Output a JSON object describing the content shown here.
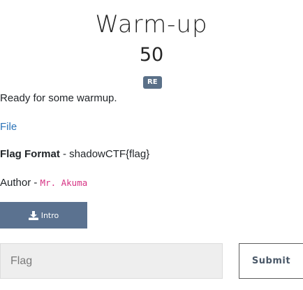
{
  "challenge": {
    "title": "Warm-up",
    "points": "50",
    "category": "RE",
    "description": "Ready for some warmup.",
    "file_link": "File",
    "flag_format_label": "Flag Format",
    "flag_format_value": " - shadowCTF{flag}",
    "author_label": "Author - ",
    "author_name": "Mr. Akuma"
  },
  "actions": {
    "intro_label": "Intro",
    "intro_icon": "download-icon",
    "flag_placeholder": "Flag",
    "flag_value": "",
    "submit_label": "Submit"
  },
  "colors": {
    "badge": "#5a7088",
    "intro_button": "#5b7290",
    "link": "#2a73b8",
    "author": "#d63384"
  }
}
